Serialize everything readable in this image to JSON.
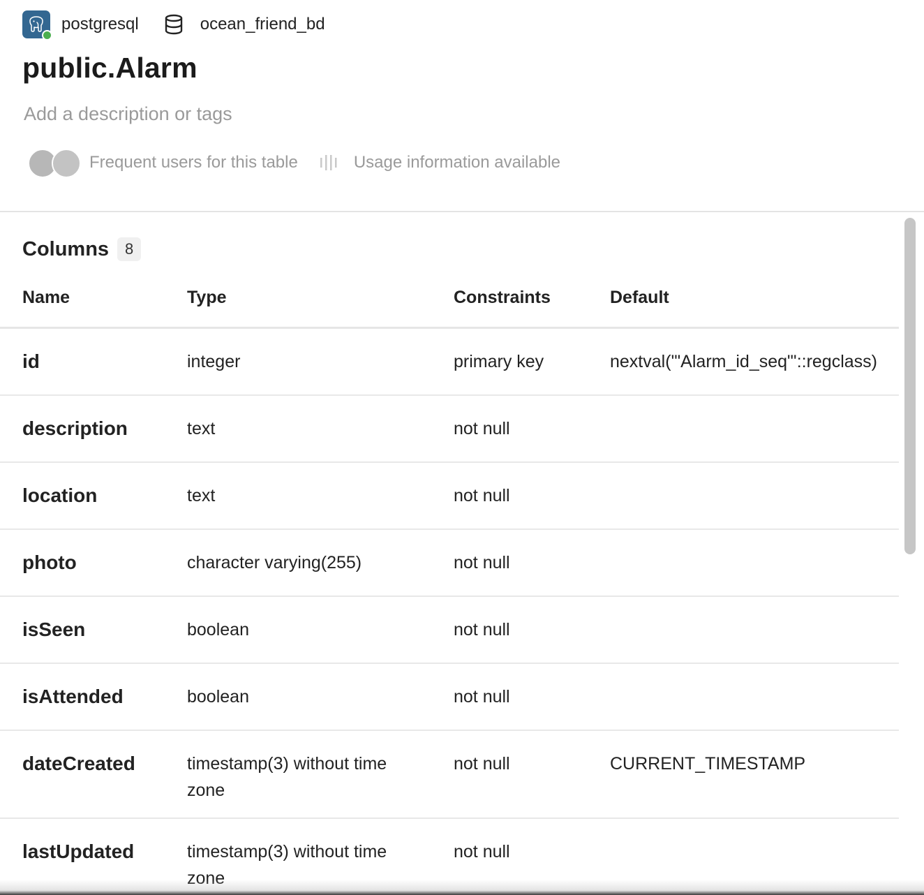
{
  "breadcrumb": {
    "engine": "postgresql",
    "database": "ocean_friend_bd"
  },
  "title": "public.Alarm",
  "description_placeholder": "Add a description or tags",
  "meta": {
    "frequent_users": "Frequent users for this table",
    "usage": "Usage information available"
  },
  "columns_section": {
    "label": "Columns",
    "count": "8"
  },
  "table": {
    "headers": {
      "name": "Name",
      "type": "Type",
      "constraints": "Constraints",
      "default": "Default"
    },
    "rows": [
      {
        "name": "id",
        "type": "integer",
        "constraints": "primary key",
        "default": "nextval('\"Alarm_id_seq\"'::regclass)"
      },
      {
        "name": "description",
        "type": "text",
        "constraints": "not null",
        "default": ""
      },
      {
        "name": "location",
        "type": "text",
        "constraints": "not null",
        "default": ""
      },
      {
        "name": "photo",
        "type": "character varying(255)",
        "constraints": "not null",
        "default": ""
      },
      {
        "name": "isSeen",
        "type": "boolean",
        "constraints": "not null",
        "default": ""
      },
      {
        "name": "isAttended",
        "type": "boolean",
        "constraints": "not null",
        "default": ""
      },
      {
        "name": "dateCreated",
        "type": "timestamp(3) without time zone",
        "constraints": "not null",
        "default": "CURRENT_TIMESTAMP"
      },
      {
        "name": "lastUpdated",
        "type": "timestamp(3) without time zone",
        "constraints": "not null",
        "default": ""
      }
    ]
  },
  "icons": {
    "engine": "postgresql-elephant-icon",
    "database": "database-cylinder-icon",
    "usage": "usage-bars-icon",
    "status_color": "#4caf50",
    "engine_color": "#336791"
  }
}
